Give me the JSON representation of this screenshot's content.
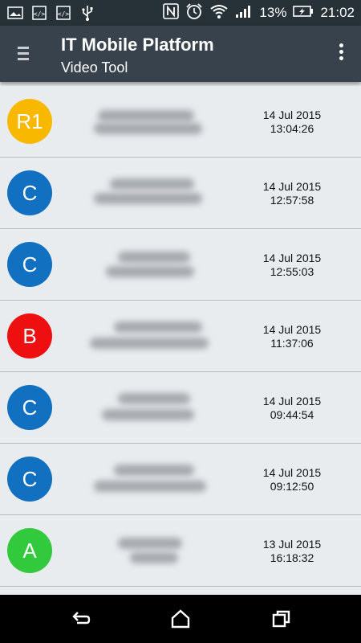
{
  "statusbar": {
    "battery_percent": "13%",
    "time": "21:02",
    "icons": [
      "image-icon",
      "code-icon",
      "code-icon",
      "usb-icon",
      "nfc-icon",
      "alarm-icon",
      "wifi-icon",
      "signal-icon",
      "battery-charging-icon"
    ]
  },
  "appbar": {
    "title": "IT Mobile Platform",
    "subtitle": "Video Tool"
  },
  "colors": {
    "R1": "#f9b800",
    "C": "#1270c1",
    "B": "#ee1010",
    "A": "#33c93d"
  },
  "items": [
    {
      "badge": "R1",
      "color": "#f9b800",
      "date": "14 Jul 2015",
      "time": "13:04:26"
    },
    {
      "badge": "C",
      "color": "#1270c1",
      "date": "14 Jul 2015",
      "time": "12:57:58"
    },
    {
      "badge": "C",
      "color": "#1270c1",
      "date": "14 Jul 2015",
      "time": "12:55:03"
    },
    {
      "badge": "B",
      "color": "#ee1010",
      "date": "14 Jul 2015",
      "time": "11:37:06"
    },
    {
      "badge": "C",
      "color": "#1270c1",
      "date": "14 Jul 2015",
      "time": "09:44:54"
    },
    {
      "badge": "C",
      "color": "#1270c1",
      "date": "14 Jul 2015",
      "time": "09:12:50"
    },
    {
      "badge": "A",
      "color": "#33c93d",
      "date": "13 Jul 2015",
      "time": "16:18:32"
    }
  ],
  "navbar": {
    "icons": [
      "back-icon",
      "home-icon",
      "recents-icon"
    ]
  }
}
